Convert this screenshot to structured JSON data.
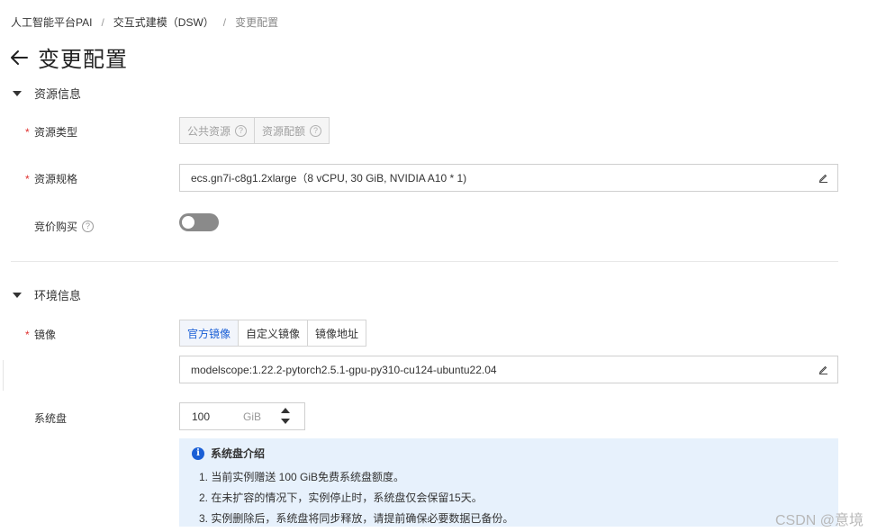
{
  "breadcrumb": {
    "items": [
      "人工智能平台PAI",
      "交互式建模（DSW）"
    ],
    "separator": "/",
    "current": "变更配置"
  },
  "page": {
    "title": "变更配置",
    "back_icon": "arrow-left-icon"
  },
  "resource_section": {
    "title": "资源信息",
    "resource_type": {
      "label": "资源类型",
      "required": "*",
      "options": [
        "公共资源",
        "资源配额"
      ]
    },
    "resource_spec": {
      "label": "资源规格",
      "required": "*",
      "value": "ecs.gn7i-c8g1.2xlarge（8 vCPU, 30 GiB, NVIDIA A10 * 1)"
    },
    "bidding": {
      "label": "竞价购买",
      "enabled": false
    }
  },
  "env_section": {
    "title": "环境信息",
    "image": {
      "label": "镜像",
      "required": "*",
      "tabs": [
        "官方镜像",
        "自定义镜像",
        "镜像地址"
      ],
      "active_tab": "官方镜像",
      "value": "modelscope:1.22.2-pytorch2.5.1-gpu-py310-cu124-ubuntu22.04"
    },
    "system_disk": {
      "label": "系统盘",
      "value": "100",
      "unit": "GiB"
    },
    "notice": {
      "title": "系统盘介绍",
      "items": [
        "1. 当前实例赠送 100 GiB免费系统盘额度。",
        "2. 在未扩容的情况下，实例停止时，系统盘仅会保留15天。",
        "3. 实例删除后，系统盘将同步释放，请提前确保必要数据已备份。"
      ]
    }
  },
  "help_glyph": "?",
  "info_glyph": "i",
  "watermark": "CSDN @意境",
  "colors": {
    "accent": "#1a5fd6",
    "required": "#e0312f",
    "notice_bg": "#e7f1fc",
    "toggle_off": "#8a8a8a"
  }
}
